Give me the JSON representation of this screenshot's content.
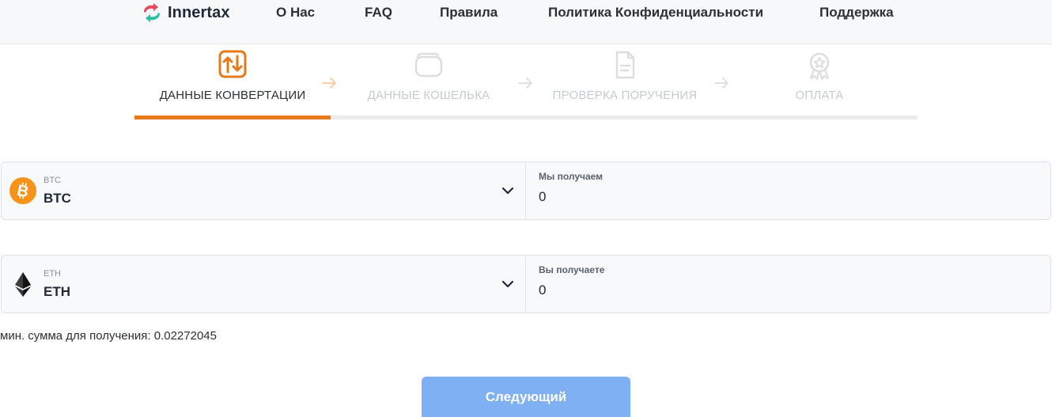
{
  "header": {
    "logo_text": "Innertax",
    "nav": [
      "О Нас",
      "FAQ",
      "Правила",
      "Политика Конфиденциальности",
      "Поддержка"
    ]
  },
  "stepper": {
    "steps": [
      {
        "label": "ДАННЫЕ КОНВЕРТАЦИИ",
        "icon": "swap-vertical-icon",
        "active": true
      },
      {
        "label": "ДАННЫЕ КОШЕЛЬКА",
        "icon": "wallet-icon",
        "active": false
      },
      {
        "label": "ПРОВЕРКА ПОРУЧЕНИЯ",
        "icon": "document-icon",
        "active": false
      },
      {
        "label": "ОПЛАТА",
        "icon": "badge-icon",
        "active": false
      }
    ],
    "progress": 0.25
  },
  "send": {
    "coin_small": "BTC",
    "coin_big": "BTC",
    "coin_icon": "bitcoin-icon",
    "amount_label": "Мы получаем",
    "amount_value": "0"
  },
  "receive": {
    "coin_small": "ETH",
    "coin_big": "ETH",
    "coin_icon": "ethereum-icon",
    "amount_label": "Вы получаете",
    "amount_value": "0"
  },
  "min_note": "мин. сумма для получения: 0.02272045",
  "next_button": "Следующий",
  "colors": {
    "accent": "#e67a18",
    "button": "#7fb0f3",
    "bitcoin": "#f7931a",
    "inactive": "#c7cad0"
  }
}
